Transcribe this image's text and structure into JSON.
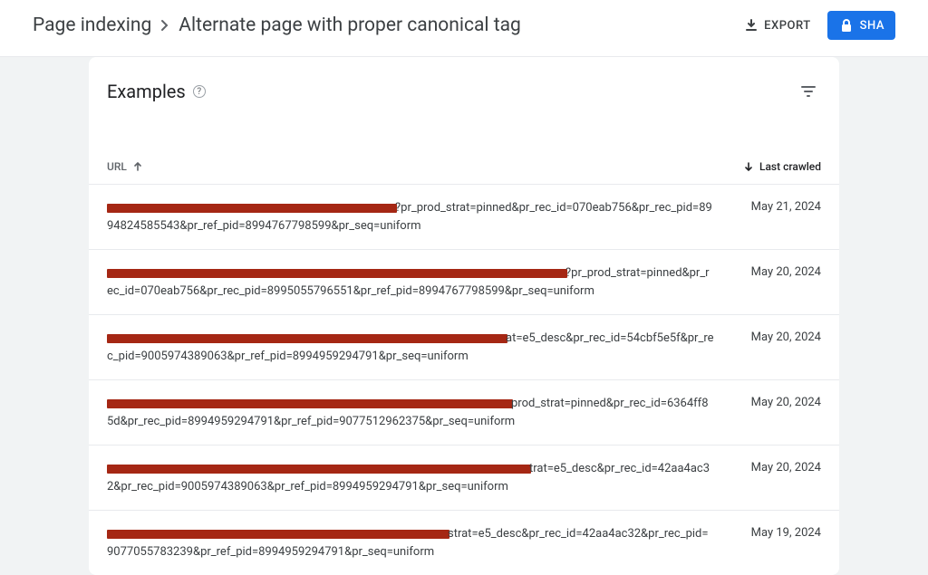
{
  "breadcrumb": {
    "parent": "Page indexing",
    "current": "Alternate page with proper canonical tag"
  },
  "header": {
    "export_label": "EXPORT",
    "share_label": "SHA"
  },
  "card": {
    "title": "Examples",
    "columns": {
      "url": "URL",
      "last_crawled": "Last crawled"
    }
  },
  "rows": [
    {
      "redact_width": 320,
      "url_suffix": "?pr_prod_strat=pinned&pr_rec_id=070eab756&pr_rec_pid=8994824585543&pr_ref_pid=8994767798599&pr_seq=uniform",
      "date": "May 21, 2024"
    },
    {
      "redact_width": 508,
      "url_suffix": "?pr_prod_strat=pinned&pr_rec_id=070eab756&pr_rec_pid=8995055796551&pr_ref_pid=8994767798599&pr_seq=uniform",
      "date": "May 20, 2024"
    },
    {
      "redact_width": 442,
      "url_suffix": "at=e5_desc&pr_rec_id=54cbf5e5f&pr_rec_pid=9005974389063&pr_ref_pid=8994959294791&pr_seq=uniform",
      "date": "May 20, 2024"
    },
    {
      "redact_width": 448,
      "url_suffix": "prod_strat=pinned&pr_rec_id=6364ff85d&pr_rec_pid=8994959294791&pr_ref_pid=9077512962375&pr_seq=uniform",
      "date": "May 20, 2024"
    },
    {
      "redact_width": 468,
      "url_suffix": "trat=e5_desc&pr_rec_id=42aa4ac32&pr_rec_pid=9005974389063&pr_ref_pid=8994959294791&pr_seq=uniform",
      "date": "May 20, 2024"
    },
    {
      "redact_width": 378,
      "url_suffix": "strat=e5_desc&pr_rec_id=42aa4ac32&pr_rec_pid=9077055783239&pr_ref_pid=8994959294791&pr_seq=uniform",
      "date": "May 19, 2024"
    }
  ]
}
